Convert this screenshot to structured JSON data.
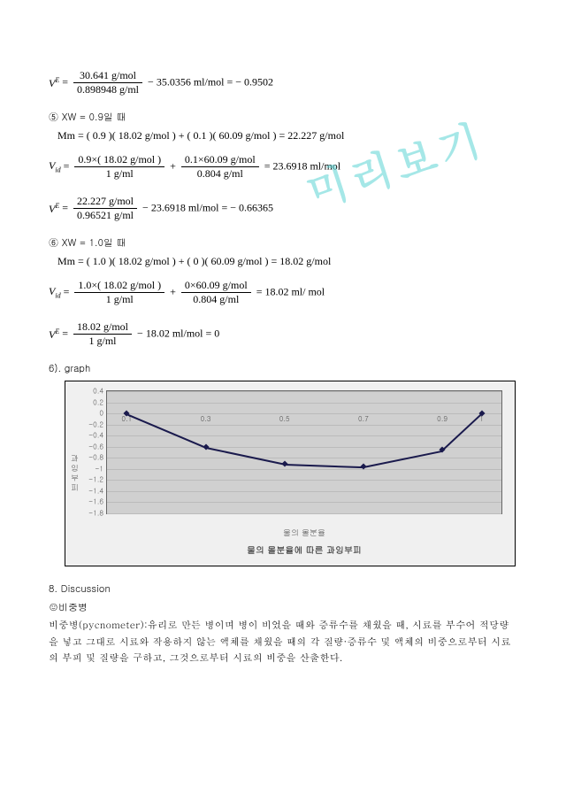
{
  "watermark": "미리보기",
  "eq1": {
    "lhs": "V",
    "sup": "E",
    "num": "30.641 g/mol",
    "den": "0.898948 g/ml",
    "minus": "35.0356 ml/mol",
    "result": "− 0.9502"
  },
  "case5": {
    "label": "⑤ X",
    "sub": "W",
    "rest": " = 0.9일 때"
  },
  "mm5": "Mm = ( 0.9 )( 18.02 g/mol ) + ( 0.1 )( 60.09 g/mol ) = 22.227 g/mol",
  "vid5": {
    "lhs": "V",
    "sub": "id",
    "num1": "0.9×( 18.02 g/mol )",
    "den1": "1 g/ml",
    "num2": "0.1×60.09 g/mol",
    "den2": "0.804 g/ml",
    "result": "23.6918 ml/mol"
  },
  "ve5": {
    "lhs": "V",
    "sup": "E",
    "num": "22.227 g/mol",
    "den": "0.96521 g/ml",
    "minus": "23.6918 ml/mol",
    "result": "− 0.66365"
  },
  "case6": {
    "label": "⑥ X",
    "sub": "W",
    "rest": " = 1.0일 때"
  },
  "mm6": "Mm = ( 1.0 )( 18.02 g/mol ) + ( 0 )( 60.09 g/mol ) = 18.02 g/mol",
  "vid6": {
    "lhs": "V",
    "sub": "id",
    "num1": "1.0×( 18.02 g/mol )",
    "den1": "1 g/ml",
    "num2": "0×60.09 g/mol",
    "den2": "0.804 g/ml",
    "result": "18.02 ml/ mol"
  },
  "ve6": {
    "lhs": "V",
    "sup": "E",
    "num": "18.02 g/mol",
    "den": "1 g/ml",
    "minus": "18.02 ml/mol",
    "result": "0"
  },
  "graph_label": "6). graph",
  "chart_data": {
    "type": "line",
    "x": [
      0.1,
      0.3,
      0.5,
      0.7,
      0.9,
      1.0
    ],
    "values": [
      0,
      -0.6,
      -0.9,
      -0.95,
      -0.66,
      0
    ],
    "xticks": [
      0.1,
      0.3,
      0.5,
      0.7,
      0.9,
      1
    ],
    "yticks": [
      0.4,
      0.2,
      0,
      -0.2,
      -0.4,
      -0.6,
      -0.8,
      -1,
      -1.2,
      -1.4,
      -1.6,
      -1.8
    ],
    "ylim": [
      -1.8,
      0.4
    ],
    "xlim": [
      0.05,
      1.05
    ],
    "ylabel": "과잉부피",
    "xlabel": "물의 몰분율",
    "title": "물의 몰분율에 따른 과잉부피"
  },
  "disc": {
    "head": "8. Discussion",
    "sub": "☺비중병",
    "body": "비중병(pycnometer):유리로 만든 병이며 병이 비었을 때와 증류수를 채웠을 때, 시료를 부수어 적당량을 넣고 그대로 시료와 작용하지 않는 액체를 채웠을 때의 각 질량·증류수 및 액체의 비중으로부터 시료의 부피 및 질량을 구하고, 그것으로부터 시료의 비중을 산출한다."
  }
}
